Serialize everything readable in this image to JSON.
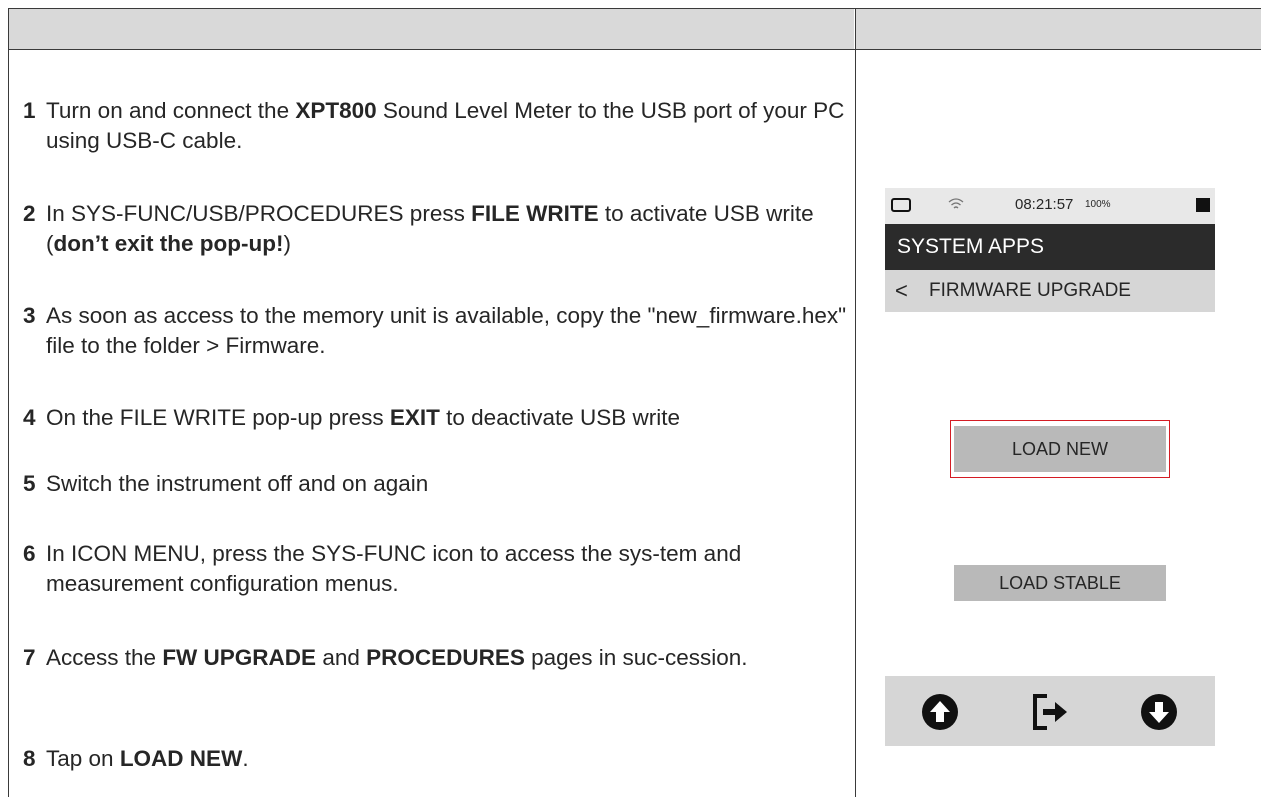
{
  "steps": [
    {
      "num": "1",
      "parts": [
        {
          "t": "Turn on and connect the ",
          "b": false
        },
        {
          "t": "XPT800",
          "b": true
        },
        {
          "t": " Sound Level Meter to the USB port of your PC using USB-C cable.",
          "b": false
        }
      ]
    },
    {
      "num": "2",
      "parts": [
        {
          "t": "In SYS-FUNC/USB/PROCEDURES press ",
          "b": false
        },
        {
          "t": "FILE WRITE",
          "b": true
        },
        {
          "t": " to activate USB write (",
          "b": false
        },
        {
          "t": "don’t exit the pop-up!",
          "b": true
        },
        {
          "t": ")",
          "b": false
        }
      ]
    },
    {
      "num": "3",
      "parts": [
        {
          "t": "As soon as access to the memory unit is available, copy the \"new_firmware.hex\" file to the folder > Firmware.",
          "b": false
        }
      ]
    },
    {
      "num": "4",
      "parts": [
        {
          "t": "On the FILE WRITE pop-up press ",
          "b": false
        },
        {
          "t": "EXIT",
          "b": true
        },
        {
          "t": " to deactivate USB write",
          "b": false
        }
      ]
    },
    {
      "num": "5",
      "parts": [
        {
          "t": "Switch the instrument off and on again",
          "b": false
        }
      ]
    },
    {
      "num": "6",
      "parts": [
        {
          "t": "In ICON MENU, press the SYS-FUNC icon to access the sys-tem and measurement configuration menus.",
          "b": false
        }
      ]
    },
    {
      "num": "7",
      "parts": [
        {
          "t": "Access the ",
          "b": false
        },
        {
          "t": "FW UPGRADE",
          "b": true
        },
        {
          "t": " and ",
          "b": false
        },
        {
          "t": "PROCEDURES",
          "b": true
        },
        {
          "t": " pages in suc-cession.",
          "b": false
        }
      ]
    },
    {
      "num": "8",
      "parts": [
        {
          "t": "Tap on ",
          "b": false
        },
        {
          "t": "LOAD NEW",
          "b": true
        },
        {
          "t": ".",
          "b": false
        }
      ]
    }
  ],
  "device": {
    "status": {
      "time": "08:21:57",
      "battery": "100%"
    },
    "title": "SYSTEM APPS",
    "subtitle": "FIRMWARE UPGRADE",
    "back_glyph": "<",
    "buttons": {
      "load_new": "LOAD NEW",
      "load_stable": "LOAD STABLE"
    },
    "highlight_color": "#d41c24",
    "icons": [
      "battery-icon",
      "wifi-icon",
      "stop-icon",
      "back-icon",
      "arrow-up-icon",
      "exit-icon",
      "arrow-down-icon"
    ]
  }
}
